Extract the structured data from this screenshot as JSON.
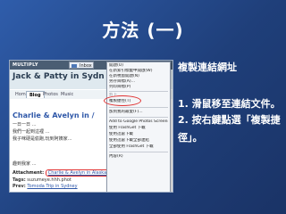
{
  "slide": {
    "title": "方法 (一)",
    "heading": "複製連結網址",
    "steps": [
      "1. 滑鼠移至連結文件。",
      "2. 按右鍵點選「複製捷",
      "徑」。"
    ]
  },
  "screenshot": {
    "logo": "MULTIPLY",
    "inbox_label": "Inbox",
    "blog_title": "Jack & Patty in Sydn",
    "tabs": [
      "Home",
      "Blog",
      "Photos",
      "Music"
    ],
    "active_tab": "Blog",
    "post_title": "Charlie & Avelyn in /",
    "content_lines": [
      "一日一日 …",
      "我們一起到這裡 …",
      "我子咪硬是偷跑,玩到阿姨家…",
      "",
      "趣到我家 …"
    ],
    "attachment_label": "Attachment:",
    "attachment_link": "Charlie & Avelyn in Alaska.ppt",
    "tags_label": "Tags:",
    "tags_value": "suzumeye.hhh.phot",
    "prev_label": "Prev:",
    "prev_link": "Tomoda Trip in Sydney"
  },
  "context_menu": {
    "items": [
      {
        "label": "開啟(O)",
        "disabled": false
      },
      {
        "label": "在新索引標籤中開啟(W)",
        "disabled": false
      },
      {
        "label": "在新視窗開啟(N)",
        "disabled": false
      },
      {
        "label": "另存目標(A)…",
        "disabled": false
      },
      {
        "label": "列印目標(P)",
        "disabled": false
      },
      {
        "label": "",
        "separator": true
      },
      {
        "label": "剪下",
        "disabled": true
      },
      {
        "label": "複製捷徑(T)",
        "disabled": false,
        "highlight": true
      },
      {
        "label": "",
        "separator": true
      },
      {
        "label": "加到我的最愛(F)…",
        "disabled": false
      },
      {
        "label": "",
        "separator": true
      },
      {
        "label": "Add to Google Photos Screensaver",
        "disabled": false
      },
      {
        "label": "使用 FlashGet 下載",
        "disabled": false
      },
      {
        "label": "使用迅雷下載",
        "disabled": false
      },
      {
        "label": "使用迅雷下載全部連結",
        "disabled": false
      },
      {
        "label": "全部使用 FlashGet 下載",
        "disabled": false
      },
      {
        "label": "",
        "separator": true
      },
      {
        "label": "內容(R)",
        "disabled": false
      }
    ]
  },
  "colors": {
    "background": "#2a4f96",
    "highlight_ring": "#e03030",
    "link": "#2e57a8"
  }
}
